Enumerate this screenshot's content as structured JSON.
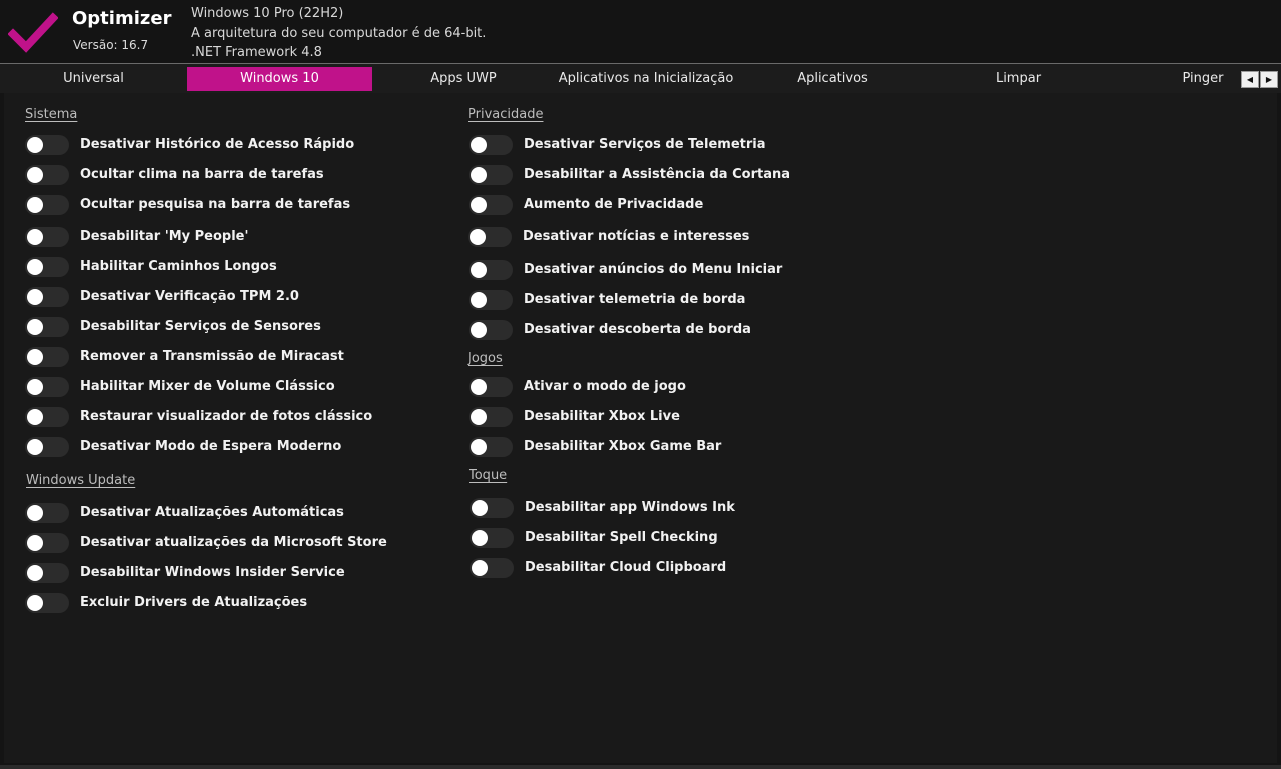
{
  "app": {
    "title": "Optimizer",
    "version": "Versão: 16.7",
    "accent_color": "#c0128a"
  },
  "system_info": {
    "os": "Windows 10 Pro (22H2)",
    "arch": "A arquitetura do seu computador é de 64-bit.",
    "framework": ".NET Framework 4.8"
  },
  "tabs": [
    {
      "label": "Universal",
      "active": false
    },
    {
      "label": "Windows 10",
      "active": true
    },
    {
      "label": "Apps UWP",
      "active": false
    },
    {
      "label": "Aplicativos na Inicialização",
      "active": false
    },
    {
      "label": "Aplicativos",
      "active": false
    },
    {
      "label": "Limpar",
      "active": false
    },
    {
      "label": "Pinger",
      "active": false
    }
  ],
  "tab_scroll": {
    "left_icon": "chevron-left-icon",
    "right_icon": "chevron-right-icon"
  },
  "sections": {
    "sistema": {
      "title": "Sistema",
      "items": [
        {
          "label": "Desativar Histórico de Acesso Rápido",
          "on": false
        },
        {
          "label": "Ocultar clima na barra de tarefas",
          "on": false
        },
        {
          "label": "Ocultar pesquisa na barra de tarefas",
          "on": false
        },
        {
          "label": "Desabilitar 'My People'",
          "on": false
        },
        {
          "label": "Habilitar Caminhos Longos",
          "on": false
        },
        {
          "label": "Desativar Verificação TPM 2.0",
          "on": false
        },
        {
          "label": "Desabilitar Serviços de Sensores",
          "on": false
        },
        {
          "label": "Remover a Transmissão de Miracast",
          "on": false
        },
        {
          "label": "Habilitar Mixer de Volume Clássico",
          "on": false
        },
        {
          "label": "Restaurar visualizador de fotos clássico",
          "on": false
        },
        {
          "label": "Desativar Modo de Espera Moderno",
          "on": false
        }
      ]
    },
    "windows_update": {
      "title": "Windows Update",
      "items": [
        {
          "label": "Desativar Atualizações Automáticas",
          "on": false
        },
        {
          "label": "Desativar atualizações da Microsoft Store",
          "on": false
        },
        {
          "label": "Desabilitar Windows Insider Service",
          "on": false
        },
        {
          "label": "Excluir Drivers de Atualizações",
          "on": false
        }
      ]
    },
    "privacidade": {
      "title": "Privacidade",
      "items": [
        {
          "label": "Desativar Serviços de Telemetria",
          "on": false
        },
        {
          "label": "Desabilitar a Assistência da Cortana",
          "on": false
        },
        {
          "label": "Aumento de Privacidade",
          "on": false
        },
        {
          "label": "Desativar notícias e interesses",
          "on": false
        },
        {
          "label": "Desativar anúncios do Menu Iniciar",
          "on": false
        },
        {
          "label": "Desativar telemetria de borda",
          "on": false
        },
        {
          "label": "Desativar descoberta de borda",
          "on": false
        }
      ]
    },
    "jogos": {
      "title": "Jogos",
      "items": [
        {
          "label": "Ativar o modo de jogo",
          "on": false
        },
        {
          "label": "Desabilitar Xbox Live",
          "on": false
        },
        {
          "label": "Desabilitar Xbox Game Bar",
          "on": false
        }
      ]
    },
    "toque": {
      "title": "Toque",
      "items": [
        {
          "label": "Desabilitar app Windows Ink",
          "on": false
        },
        {
          "label": "Desabilitar Spell Checking",
          "on": false
        },
        {
          "label": "Desabilitar Cloud Clipboard",
          "on": false
        }
      ]
    }
  }
}
